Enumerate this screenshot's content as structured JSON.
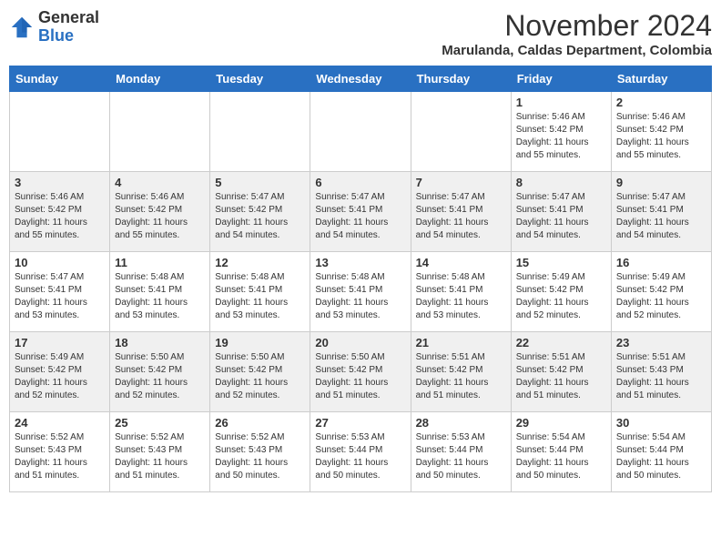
{
  "logo": {
    "general": "General",
    "blue": "Blue"
  },
  "header": {
    "month": "November 2024",
    "location": "Marulanda, Caldas Department, Colombia"
  },
  "weekdays": [
    "Sunday",
    "Monday",
    "Tuesday",
    "Wednesday",
    "Thursday",
    "Friday",
    "Saturday"
  ],
  "weeks": [
    [
      {
        "day": "",
        "info": ""
      },
      {
        "day": "",
        "info": ""
      },
      {
        "day": "",
        "info": ""
      },
      {
        "day": "",
        "info": ""
      },
      {
        "day": "",
        "info": ""
      },
      {
        "day": "1",
        "info": "Sunrise: 5:46 AM\nSunset: 5:42 PM\nDaylight: 11 hours\nand 55 minutes."
      },
      {
        "day": "2",
        "info": "Sunrise: 5:46 AM\nSunset: 5:42 PM\nDaylight: 11 hours\nand 55 minutes."
      }
    ],
    [
      {
        "day": "3",
        "info": "Sunrise: 5:46 AM\nSunset: 5:42 PM\nDaylight: 11 hours\nand 55 minutes."
      },
      {
        "day": "4",
        "info": "Sunrise: 5:46 AM\nSunset: 5:42 PM\nDaylight: 11 hours\nand 55 minutes."
      },
      {
        "day": "5",
        "info": "Sunrise: 5:47 AM\nSunset: 5:42 PM\nDaylight: 11 hours\nand 54 minutes."
      },
      {
        "day": "6",
        "info": "Sunrise: 5:47 AM\nSunset: 5:41 PM\nDaylight: 11 hours\nand 54 minutes."
      },
      {
        "day": "7",
        "info": "Sunrise: 5:47 AM\nSunset: 5:41 PM\nDaylight: 11 hours\nand 54 minutes."
      },
      {
        "day": "8",
        "info": "Sunrise: 5:47 AM\nSunset: 5:41 PM\nDaylight: 11 hours\nand 54 minutes."
      },
      {
        "day": "9",
        "info": "Sunrise: 5:47 AM\nSunset: 5:41 PM\nDaylight: 11 hours\nand 54 minutes."
      }
    ],
    [
      {
        "day": "10",
        "info": "Sunrise: 5:47 AM\nSunset: 5:41 PM\nDaylight: 11 hours\nand 53 minutes."
      },
      {
        "day": "11",
        "info": "Sunrise: 5:48 AM\nSunset: 5:41 PM\nDaylight: 11 hours\nand 53 minutes."
      },
      {
        "day": "12",
        "info": "Sunrise: 5:48 AM\nSunset: 5:41 PM\nDaylight: 11 hours\nand 53 minutes."
      },
      {
        "day": "13",
        "info": "Sunrise: 5:48 AM\nSunset: 5:41 PM\nDaylight: 11 hours\nand 53 minutes."
      },
      {
        "day": "14",
        "info": "Sunrise: 5:48 AM\nSunset: 5:41 PM\nDaylight: 11 hours\nand 53 minutes."
      },
      {
        "day": "15",
        "info": "Sunrise: 5:49 AM\nSunset: 5:42 PM\nDaylight: 11 hours\nand 52 minutes."
      },
      {
        "day": "16",
        "info": "Sunrise: 5:49 AM\nSunset: 5:42 PM\nDaylight: 11 hours\nand 52 minutes."
      }
    ],
    [
      {
        "day": "17",
        "info": "Sunrise: 5:49 AM\nSunset: 5:42 PM\nDaylight: 11 hours\nand 52 minutes."
      },
      {
        "day": "18",
        "info": "Sunrise: 5:50 AM\nSunset: 5:42 PM\nDaylight: 11 hours\nand 52 minutes."
      },
      {
        "day": "19",
        "info": "Sunrise: 5:50 AM\nSunset: 5:42 PM\nDaylight: 11 hours\nand 52 minutes."
      },
      {
        "day": "20",
        "info": "Sunrise: 5:50 AM\nSunset: 5:42 PM\nDaylight: 11 hours\nand 51 minutes."
      },
      {
        "day": "21",
        "info": "Sunrise: 5:51 AM\nSunset: 5:42 PM\nDaylight: 11 hours\nand 51 minutes."
      },
      {
        "day": "22",
        "info": "Sunrise: 5:51 AM\nSunset: 5:42 PM\nDaylight: 11 hours\nand 51 minutes."
      },
      {
        "day": "23",
        "info": "Sunrise: 5:51 AM\nSunset: 5:43 PM\nDaylight: 11 hours\nand 51 minutes."
      }
    ],
    [
      {
        "day": "24",
        "info": "Sunrise: 5:52 AM\nSunset: 5:43 PM\nDaylight: 11 hours\nand 51 minutes."
      },
      {
        "day": "25",
        "info": "Sunrise: 5:52 AM\nSunset: 5:43 PM\nDaylight: 11 hours\nand 51 minutes."
      },
      {
        "day": "26",
        "info": "Sunrise: 5:52 AM\nSunset: 5:43 PM\nDaylight: 11 hours\nand 50 minutes."
      },
      {
        "day": "27",
        "info": "Sunrise: 5:53 AM\nSunset: 5:44 PM\nDaylight: 11 hours\nand 50 minutes."
      },
      {
        "day": "28",
        "info": "Sunrise: 5:53 AM\nSunset: 5:44 PM\nDaylight: 11 hours\nand 50 minutes."
      },
      {
        "day": "29",
        "info": "Sunrise: 5:54 AM\nSunset: 5:44 PM\nDaylight: 11 hours\nand 50 minutes."
      },
      {
        "day": "30",
        "info": "Sunrise: 5:54 AM\nSunset: 5:44 PM\nDaylight: 11 hours\nand 50 minutes."
      }
    ]
  ]
}
